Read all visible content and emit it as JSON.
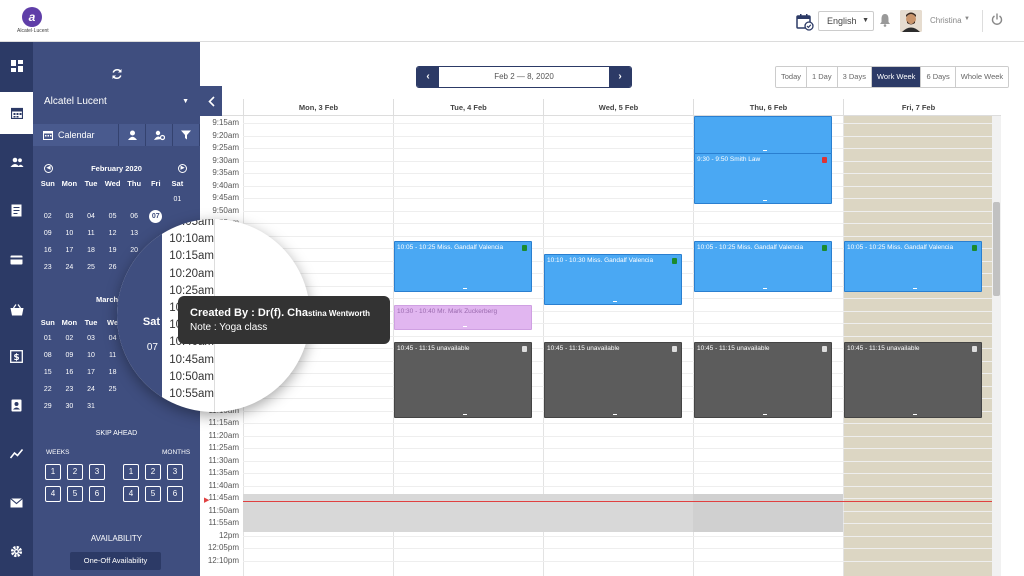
{
  "app": {
    "logo_text": "Alcatel·Lucent"
  },
  "topbar": {
    "language": "English",
    "user_name": "Christina"
  },
  "sidebar": {
    "org": "Alcatel Lucent",
    "tabs": {
      "calendar": "Calendar"
    },
    "feb": {
      "title": "February 2020",
      "dow": [
        "Sun",
        "Mon",
        "Tue",
        "Wed",
        "Thu",
        "Fri",
        "Sat"
      ],
      "rows": [
        [
          "",
          "",
          "",
          "",
          "",
          "",
          "01"
        ],
        [
          "02",
          "03",
          "04",
          "05",
          "06",
          "07",
          ""
        ],
        [
          "09",
          "10",
          "11",
          "12",
          "13",
          "",
          ""
        ],
        [
          "16",
          "17",
          "18",
          "19",
          "20",
          "",
          ""
        ],
        [
          "23",
          "24",
          "25",
          "26",
          "",
          "",
          ""
        ]
      ]
    },
    "mar": {
      "title": "March",
      "dow": [
        "Sun",
        "Mon",
        "Tue",
        "We",
        "",
        "",
        ""
      ],
      "rows": [
        [
          "01",
          "02",
          "03",
          "04",
          "",
          "",
          ""
        ],
        [
          "08",
          "09",
          "10",
          "11",
          "",
          "",
          ""
        ],
        [
          "15",
          "16",
          "17",
          "18",
          "",
          "",
          ""
        ],
        [
          "22",
          "23",
          "24",
          "25",
          "",
          "",
          ""
        ],
        [
          "29",
          "30",
          "31",
          "",
          "",
          "",
          ""
        ]
      ]
    },
    "skip_ahead": "SKIP AHEAD",
    "weeks_label": "WEEKS",
    "months_label": "MONTHS",
    "weeks": [
      "1",
      "2",
      "3",
      "4",
      "5",
      "6"
    ],
    "months": [
      "1",
      "2",
      "3",
      "4",
      "5",
      "6"
    ],
    "availability": "AVAILABILITY",
    "one_off": "One-Off Availability"
  },
  "toolbar": {
    "date_range": "Feb 2 — 8, 2020",
    "views": [
      "Today",
      "1 Day",
      "3 Days",
      "Work Week",
      "6 Days",
      "Whole Week"
    ],
    "active_view": "Work Week"
  },
  "calendar": {
    "days": [
      "Mon, 3 Feb",
      "Tue, 4 Feb",
      "Wed, 5 Feb",
      "Thu, 6 Feb",
      "Fri, 7 Feb"
    ],
    "times": [
      "9:15am",
      "9:20am",
      "9:25am",
      "9:30am",
      "9:35am",
      "9:40am",
      "9:45am",
      "9:50am",
      "9:55am",
      "10am",
      "10:05am",
      "10:10am",
      "10:15am",
      "10:20am",
      "10:25am",
      "10:30am",
      "10:35am",
      "10:40am",
      "10:45am",
      "10:50am",
      "10:55am",
      "11am",
      "11:05am",
      "11:10am",
      "11:15am",
      "11:20am",
      "11:25am",
      "11:30am",
      "11:35am",
      "11:40am",
      "11:45am",
      "11:50am",
      "11:55am",
      "12pm",
      "12:05pm",
      "12:10pm"
    ],
    "events": [
      {
        "day": 3,
        "label": "",
        "type": "blue"
      },
      {
        "day": 3,
        "label": "9:30 - 9:50 Smith Law",
        "type": "blue"
      },
      {
        "day": 1,
        "label": "10:05 - 10:25 Miss. Gandalf Valencia",
        "type": "blue"
      },
      {
        "day": 2,
        "label": "10:10 - 10:30 Miss. Gandalf Valencia",
        "type": "blue"
      },
      {
        "day": 3,
        "label": "10:05 - 10:25 Miss. Gandalf Valencia",
        "type": "blue"
      },
      {
        "day": 4,
        "label": "10:05 - 10:25 Miss. Gandalf Valencia",
        "type": "blue"
      },
      {
        "day": 1,
        "label": "10:30 - 10:40 Mr. Mark Zuckerberg",
        "type": "pink"
      },
      {
        "day": 1,
        "label": "10:45 - 11:15 unavailable",
        "type": "gray"
      },
      {
        "day": 2,
        "label": "10:45 - 11:15 unavailable",
        "type": "gray"
      },
      {
        "day": 3,
        "label": "10:45 - 11:15 unavailable",
        "type": "gray"
      },
      {
        "day": 4,
        "label": "10:45 - 11:15 unavailable",
        "type": "gray"
      }
    ]
  },
  "magnifier": {
    "sat": "Sat",
    "num": "07",
    "times": [
      "10:05am",
      "10:10am",
      "10:15am",
      "10:20am",
      "10:25am",
      "10:30am",
      "10:35am",
      "10:40am",
      "10:45am",
      "10:50am",
      "10:55am"
    ]
  },
  "tooltip": {
    "created_by_label": "Created By :",
    "created_by_value": "Dr(f). Cha",
    "created_by_rest": "stina Wentworth",
    "note_label": "Note :",
    "note_value": "Yoga class"
  },
  "colors": {
    "navy": "#2c3a66",
    "panel": "#3f4e7f",
    "event_blue": "#4aa8f3",
    "unavailable": "#5c5c5c",
    "pink": "#e1b6f0",
    "now_line": "#e04040"
  }
}
